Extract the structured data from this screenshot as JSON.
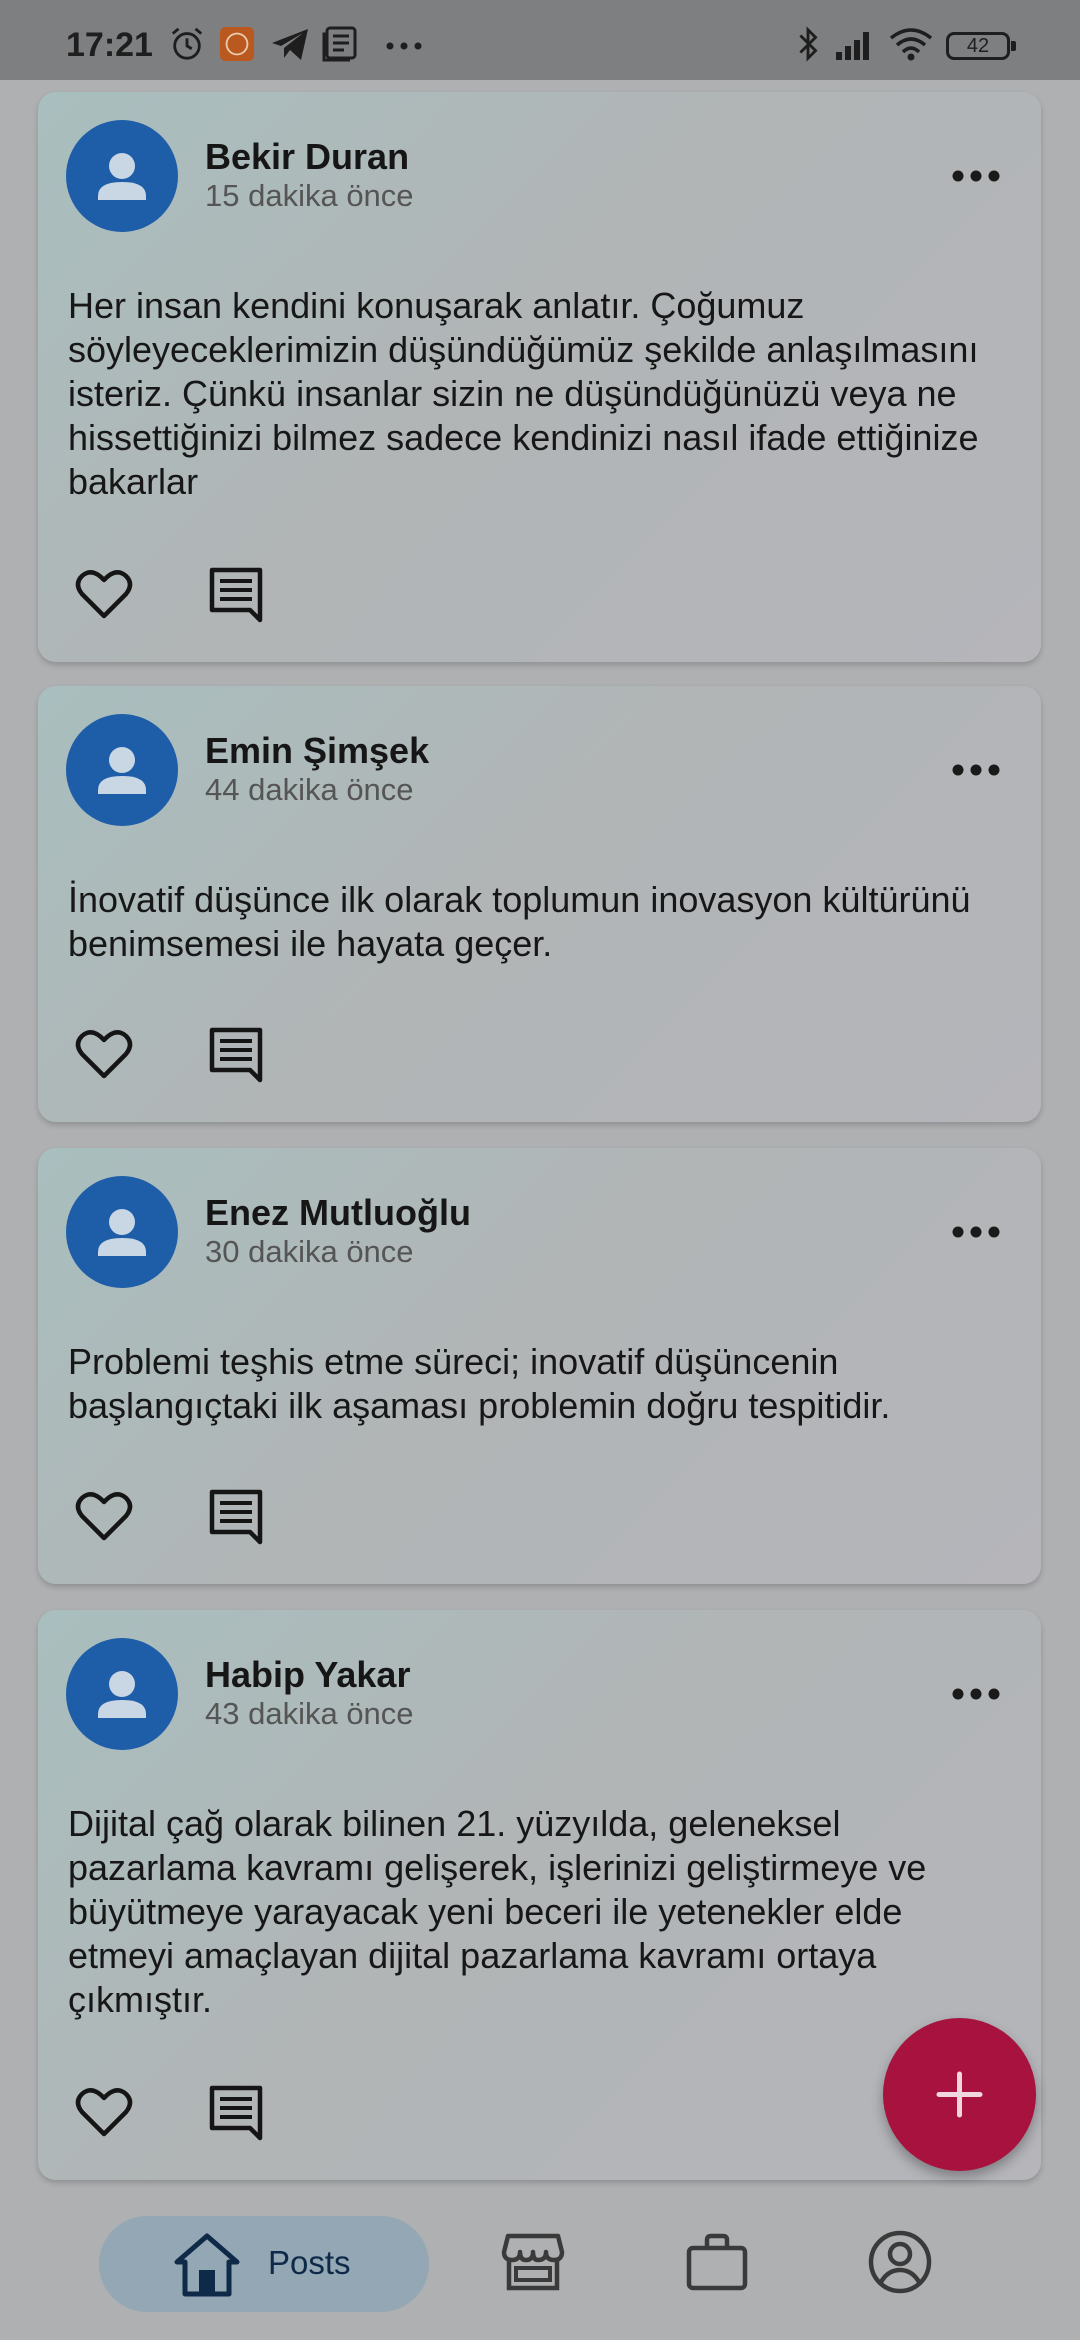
{
  "status_bar": {
    "time": "17:21",
    "battery": "42",
    "icons": [
      "alarm-icon",
      "mi-app-icon",
      "telegram-icon",
      "news-icon",
      "more-icon",
      "bluetooth-icon",
      "signal-icon",
      "wifi-icon",
      "battery-icon"
    ]
  },
  "posts": [
    {
      "author": "Bekir Duran",
      "time": "15 dakika önce",
      "text": "Her insan kendini konuşarak anlatır. Çoğumuz söyleyeceklerimizin düşündüğümüz şekilde anlaşılmasını isteriz. Çünkü insanlar sizin ne düşündüğünüzü veya ne hissettiğinizi bilmez sadece kendinizi nasıl ifade ettiğinize bakarlar"
    },
    {
      "author": "Emin Şimşek",
      "time": "44 dakika önce",
      "text": "İnovatif düşünce ilk olarak toplumun inovasyon kültürünü benimsemesi ile hayata geçer."
    },
    {
      "author": "Enez Mutluoğlu",
      "time": "30 dakika önce",
      "text": "Problemi teşhis etme süreci; inovatif düşüncenin başlangıçtaki ilk aşaması problemin doğru tespitidir."
    },
    {
      "author": "Habip Yakar",
      "time": "43 dakika önce",
      "text": "Dijital çağ olarak bilinen 21. yüzyılda, geleneksel pazarlama kavramı gelişerek, işlerinizi geliştirmeye ve büyütmeye yarayacak yeni beceri ile yetenekler elde etmeyi amaçlayan dijital pazarlama kavramı ortaya çıkmıştır."
    }
  ],
  "fab": {
    "icon": "plus-icon"
  },
  "bottom_nav": {
    "items": [
      {
        "label": "Posts",
        "icon": "home-icon",
        "active": true
      },
      {
        "label": "",
        "icon": "store-icon",
        "active": false
      },
      {
        "label": "",
        "icon": "briefcase-icon",
        "active": false
      },
      {
        "label": "",
        "icon": "account-icon",
        "active": false
      }
    ]
  },
  "colors": {
    "accent": "#a8123f",
    "avatar": "#1e5ea8",
    "nav_active_bg": "#94a7b4"
  }
}
